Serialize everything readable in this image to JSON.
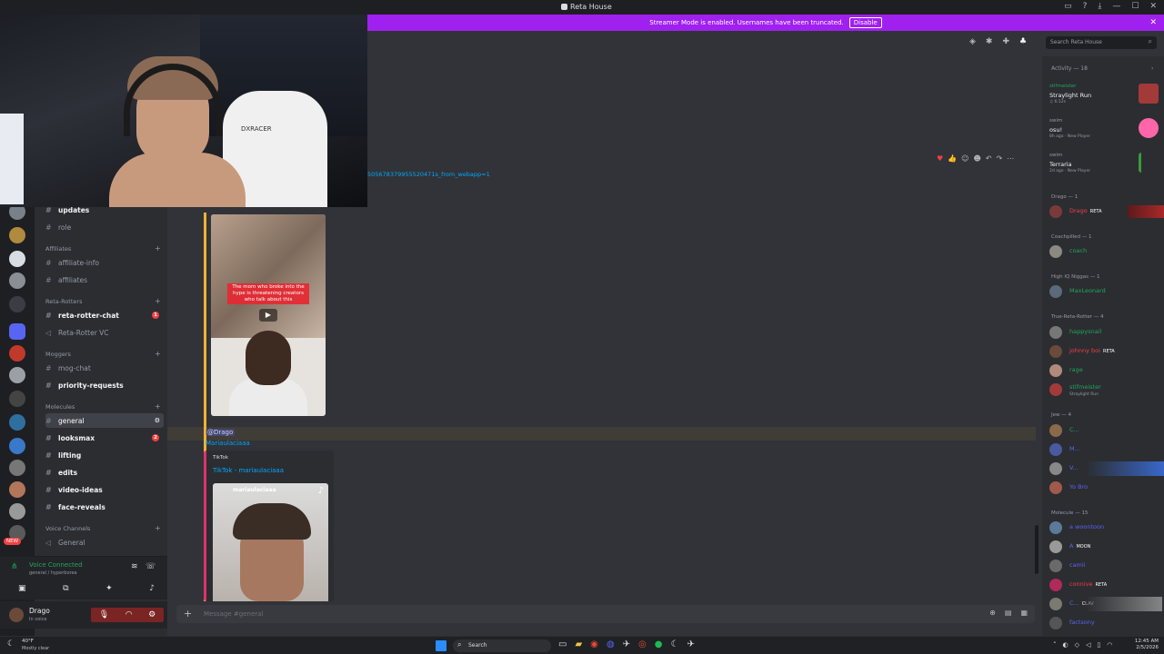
{
  "window": {
    "title": "Reta House",
    "controls": [
      "▭",
      "?",
      "⤓",
      "—",
      "☐",
      "✕"
    ]
  },
  "streamer": {
    "text": "Streamer Mode is enabled. Usernames have been truncated.",
    "disable_label": "Disable",
    "close": "✕"
  },
  "header": {
    "search_placeholder": "Search Reta House"
  },
  "webcam": {
    "chair_text": "DXRACER"
  },
  "channels": {
    "items": [
      {
        "label": "updates"
      },
      {
        "label": "role"
      },
      {
        "label": "affiliate-info"
      },
      {
        "label": "affiliates"
      },
      {
        "label": "reta-rotter-chat",
        "badge": "1"
      },
      {
        "label": "Reta-Rotter VC"
      },
      {
        "label": "mog-chat"
      },
      {
        "label": "priority-requests"
      },
      {
        "label": "general"
      },
      {
        "label": "looksmax",
        "badge": "2"
      },
      {
        "label": "lifting"
      },
      {
        "label": "edits"
      },
      {
        "label": "video-ideas"
      },
      {
        "label": "face-reveals"
      },
      {
        "label": "General"
      }
    ],
    "categories": [
      "Affiliates",
      "Reta-Rotters",
      "Moggers",
      "Molecules",
      "Voice Channels"
    ],
    "new_badge": "NEW"
  },
  "voice": {
    "status": "Voice Connected",
    "location": "general / hyperborea"
  },
  "user": {
    "name": "Drago",
    "status": "In voice"
  },
  "chat": {
    "link_fragment": "505678379955520471s_from_webapp=1",
    "mention": "@Drago",
    "sub_link": "Mariaulaciaaa",
    "embed1_caption": "The mom who broke into the hype is threatening creators who talk about this",
    "embed2_provider": "TikTok",
    "embed2_title": "TikTok - mariaulaciaaa",
    "embed2_username": "mariaulaciaaa",
    "composer_placeholder": "Message #general"
  },
  "members": {
    "activity_header": "Activity — 18",
    "activities": [
      {
        "user": "stifmeister",
        "game": "Straylight Run",
        "detail": "♫ 6:12s"
      },
      {
        "user": "swim",
        "game": "osu!",
        "detail": "8h ago · New Player"
      },
      {
        "user": "swim",
        "game": "Terraria",
        "detail": "2d ago · New Player"
      }
    ],
    "roles": [
      "Drago — 1",
      "Coachpilled — 1",
      "High IQ Niggas — 1",
      "True-Reta-Rotter — 4",
      "Jew — 4",
      "Molecule — 15"
    ],
    "list": [
      {
        "name": "Drago",
        "tag": "RETA",
        "color": "#f23f43"
      },
      {
        "name": "coach",
        "color": "#23a55a"
      },
      {
        "name": "MaxLeonard",
        "color": "#23a55a"
      },
      {
        "name": "happysnail",
        "color": "#23a55a"
      },
      {
        "name": "johnny boi",
        "tag": "RETA",
        "color": "#f23f43"
      },
      {
        "name": "rage",
        "color": "#23a55a"
      },
      {
        "name": "stifmeister",
        "sub": "Straylight Run",
        "color": "#23a55a"
      },
      {
        "name": "C...",
        "color": "#23a55a"
      },
      {
        "name": "M...",
        "color": "#5865f2"
      },
      {
        "name": "V...",
        "color": "#5865f2"
      },
      {
        "name": "Yo Bro",
        "color": "#5865f2"
      },
      {
        "name": "a woontoon",
        "color": "#5865f2"
      },
      {
        "name": "A",
        "tag": "MOON",
        "color": "#5865f2"
      },
      {
        "name": "camii",
        "color": "#5865f2"
      },
      {
        "name": "connive",
        "tag": "RETA",
        "color": "#f23f43"
      },
      {
        "name": "C...",
        "tag": "CLAV",
        "color": "#5865f2"
      },
      {
        "name": "factsony",
        "color": "#5865f2"
      }
    ]
  },
  "taskbar": {
    "weather": "40°F",
    "weather_desc": "Mostly clear",
    "search_label": "Search",
    "time": "12:45 AM",
    "date": "2/5/2026"
  }
}
